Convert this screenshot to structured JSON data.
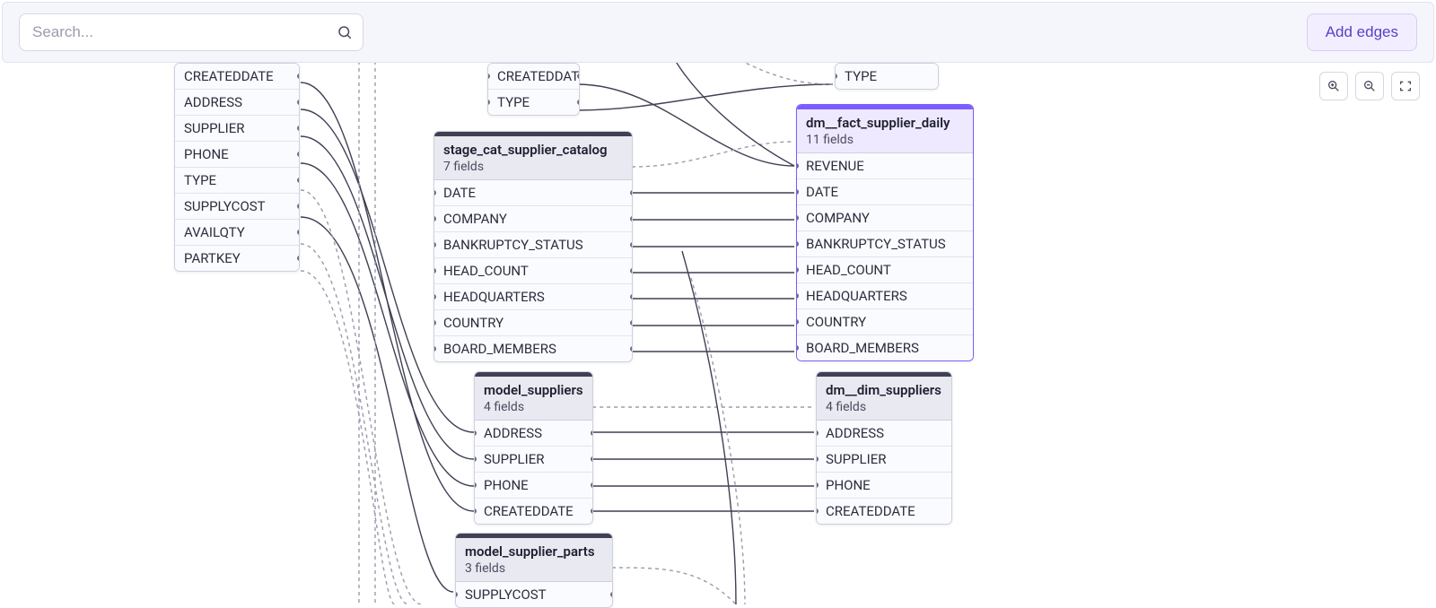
{
  "toolbar": {
    "search_placeholder": "Search...",
    "add_edges_label": "Add edges"
  },
  "nodes": {
    "left_partial": {
      "rows": [
        "CREATEDDATE",
        "ADDRESS",
        "SUPPLIER",
        "PHONE",
        "TYPE",
        "SUPPLYCOST",
        "AVAILQTY",
        "PARTKEY"
      ]
    },
    "top_mid_partial": {
      "rows": [
        "CREATEDDATE",
        "TYPE"
      ]
    },
    "top_right_partial": {
      "rows": [
        "TYPE"
      ]
    },
    "stage_cat": {
      "title": "stage_cat_supplier_catalog",
      "sub": "7 fields",
      "rows": [
        "DATE",
        "COMPANY",
        "BANKRUPTCY_STATUS",
        "HEAD_COUNT",
        "HEADQUARTERS",
        "COUNTRY",
        "BOARD_MEMBERS"
      ]
    },
    "fact_daily": {
      "title": "dm__fact_supplier_daily",
      "sub": "11 fields",
      "rows": [
        "REVENUE",
        "DATE",
        "COMPANY",
        "BANKRUPTCY_STATUS",
        "HEAD_COUNT",
        "HEADQUARTERS",
        "COUNTRY",
        "BOARD_MEMBERS"
      ]
    },
    "model_suppliers": {
      "title": "model_suppliers",
      "sub": "4 fields",
      "rows": [
        "ADDRESS",
        "SUPPLIER",
        "PHONE",
        "CREATEDDATE"
      ]
    },
    "dim_suppliers": {
      "title": "dm__dim_suppliers",
      "sub": "4 fields",
      "rows": [
        "ADDRESS",
        "SUPPLIER",
        "PHONE",
        "CREATEDDATE"
      ]
    },
    "model_supplier_parts": {
      "title": "model_supplier_parts",
      "sub": "3 fields",
      "rows": [
        "SUPPLYCOST"
      ]
    }
  }
}
